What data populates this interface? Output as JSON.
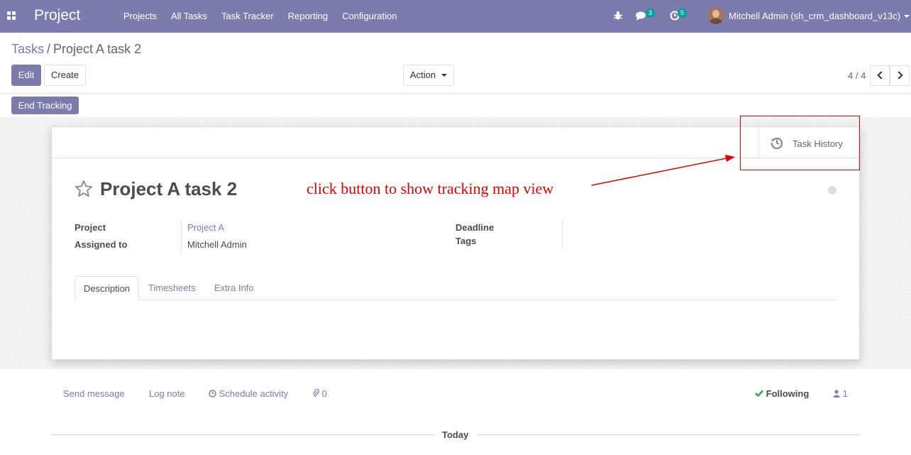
{
  "navbar": {
    "brand": "Project",
    "menu": [
      {
        "label": "Projects"
      },
      {
        "label": "All Tasks"
      },
      {
        "label": "Task Tracker"
      },
      {
        "label": "Reporting"
      },
      {
        "label": "Configuration"
      }
    ],
    "messages_count": "3",
    "activities_count": "5",
    "user_name": "Mitchell Admin (sh_crm_dashboard_v13c)"
  },
  "breadcrumb": {
    "parent": "Tasks",
    "separator": "/",
    "current": "Project A task 2"
  },
  "buttons": {
    "edit": "Edit",
    "create": "Create",
    "action": "Action",
    "end_tracking": "End Tracking"
  },
  "pager": {
    "value": "4 / 4"
  },
  "form": {
    "task_history_label": "Task History",
    "title": "Project A task 2",
    "fields": {
      "project_label": "Project",
      "project_value": "Project A",
      "assigned_label": "Assigned to",
      "assigned_value": "Mitchell Admin",
      "deadline_label": "Deadline",
      "tags_label": "Tags"
    },
    "tabs": [
      {
        "label": "Description"
      },
      {
        "label": "Timesheets"
      },
      {
        "label": "Extra Info"
      }
    ]
  },
  "annotation": {
    "text": "click button to show tracking map view"
  },
  "chatter": {
    "send_message": "Send message",
    "log_note": "Log note",
    "schedule_activity": "Schedule activity",
    "attachments_count": "0",
    "following": "Following",
    "followers_count": "1",
    "today": "Today"
  },
  "colors": {
    "brand": "#7c7bad",
    "annotation": "#e00000",
    "following_check": "#28a745",
    "badge": "#00a09d"
  },
  "icons": [
    "apps-icon",
    "bug-icon",
    "chat-icon",
    "clock-icon",
    "caret-down-icon",
    "chevron-left-icon",
    "chevron-right-icon",
    "history-icon",
    "star-icon",
    "paperclip-icon",
    "check-icon",
    "user-icon"
  ]
}
